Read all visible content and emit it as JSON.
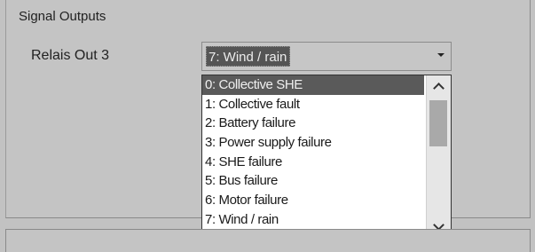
{
  "group": {
    "title": "Signal Outputs"
  },
  "field": {
    "label": "Relais Out 3",
    "value": "7: Wind / rain"
  },
  "dropdown": {
    "items": [
      "0: Collective SHE",
      "1: Collective fault",
      "2: Battery failure",
      "3: Power supply failure",
      "4: SHE failure",
      "5: Bus failure",
      "6: Motor failure",
      "7: Wind / rain"
    ],
    "highlighted_index": 0
  },
  "icons": {
    "combo_arrow": "dropdown-arrow-icon",
    "scroll_up": "chevron-up-icon",
    "scroll_down": "chevron-down-icon"
  }
}
